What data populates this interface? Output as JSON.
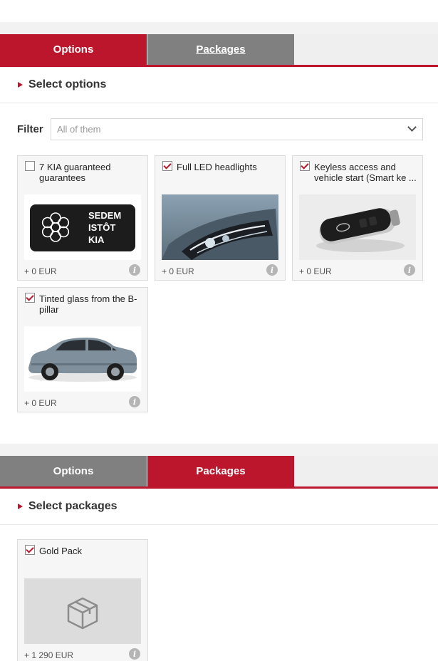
{
  "tabs_top": [
    {
      "label": "Options"
    },
    {
      "label": "Packages"
    }
  ],
  "options_section": {
    "title": "Select options",
    "filter_label": "Filter",
    "filter_value": "All of them",
    "items": [
      {
        "title": "7 KIA guaranteed guarantees",
        "checked": false,
        "price": "+ 0 EUR",
        "image": "kia-seal"
      },
      {
        "title": "Full LED headlights",
        "checked": true,
        "price": "+ 0 EUR",
        "image": "headlight"
      },
      {
        "title": "Keyless access and vehicle start (Smart ke ...",
        "checked": true,
        "price": "+ 0 EUR",
        "image": "smart-key"
      },
      {
        "title": "Tinted glass from the B-pillar",
        "checked": true,
        "price": "+ 0 EUR",
        "image": "car-side"
      }
    ]
  },
  "tabs_bottom": [
    {
      "label": "Options"
    },
    {
      "label": "Packages"
    }
  ],
  "packages_section": {
    "title": "Select packages",
    "items": [
      {
        "title": "Gold Pack",
        "checked": true,
        "price": "+ 1 290 EUR",
        "image": "package-box"
      }
    ]
  },
  "seal_text": [
    "SEDEM",
    "ISTÔT",
    "KIA"
  ],
  "colors": {
    "accent": "#bb162b",
    "inactive_tab": "#808080"
  }
}
